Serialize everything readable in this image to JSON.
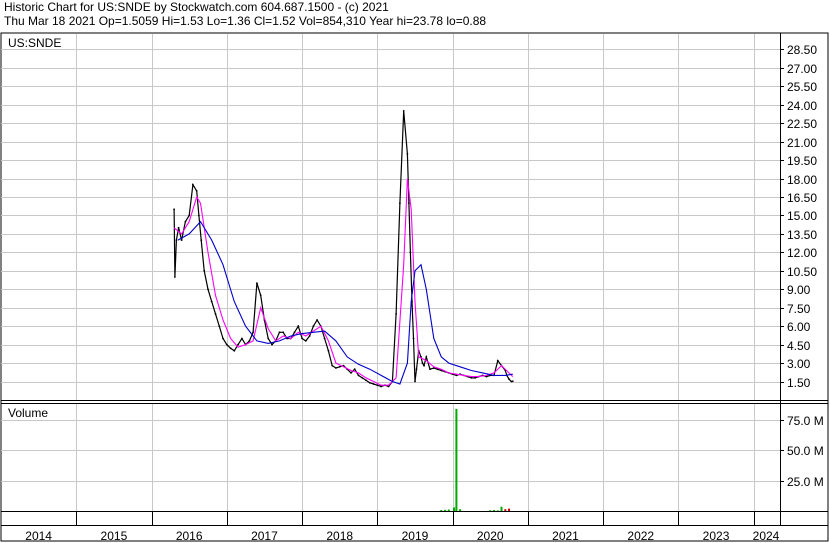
{
  "header": {
    "line1": "Historic Chart for US:SNDE by Stockwatch.com 604.687.1500 - (c) 2021",
    "line2": "Thu Mar 18 2021  Op=1.5059  Hi=1.53  Lo=1.36  Cl=1.52  Vol=854,310  Year hi=23.78  lo=0.88"
  },
  "colors": {
    "price": "#000000",
    "ma_short": "#ff00ff",
    "ma_long": "#0000cc",
    "volume": "#00aa00",
    "volume_down": "#dd0000",
    "grid": "#c8c8c8"
  },
  "chart_data": [
    {
      "type": "line",
      "title": "US:SNDE",
      "y_ticks": [
        "28.50",
        "27.00",
        "25.50",
        "24.00",
        "22.50",
        "21.00",
        "19.50",
        "18.00",
        "16.50",
        "15.00",
        "13.50",
        "12.00",
        "10.50",
        "9.00",
        "7.50",
        "6.00",
        "4.50",
        "3.00",
        "1.50"
      ],
      "y_tick_values": [
        28.5,
        27,
        25.5,
        24,
        22.5,
        21,
        19.5,
        18,
        16.5,
        15,
        13.5,
        12,
        10.5,
        9,
        7.5,
        6,
        4.5,
        3,
        1.5
      ],
      "ylim": [
        0,
        29.75
      ],
      "xlim": [
        2014.0,
        2024.35
      ],
      "x_ticks": [
        "2014",
        "2015",
        "2016",
        "2017",
        "2018",
        "2019",
        "2020",
        "2021",
        "2022",
        "2023",
        "2024"
      ],
      "grid": true,
      "series": [
        {
          "role": "price",
          "x": [
            2016.3,
            2016.31,
            2016.33,
            2016.36,
            2016.4,
            2016.45,
            2016.5,
            2016.55,
            2016.6,
            2016.63,
            2016.66,
            2016.7,
            2016.75,
            2016.8,
            2016.85,
            2016.9,
            2016.95,
            2017.0,
            2017.05,
            2017.1,
            2017.15,
            2017.2,
            2017.25,
            2017.3,
            2017.35,
            2017.4,
            2017.45,
            2017.5,
            2017.55,
            2017.6,
            2017.65,
            2017.7,
            2017.75,
            2017.8,
            2017.85,
            2017.9,
            2017.95,
            2018.0,
            2018.05,
            2018.1,
            2018.15,
            2018.2,
            2018.25,
            2018.3,
            2018.35,
            2018.4,
            2018.45,
            2018.5,
            2018.55,
            2018.6,
            2018.65,
            2018.7,
            2018.75,
            2018.8,
            2018.85,
            2018.9,
            2018.95,
            2019.0,
            2019.05,
            2019.1,
            2019.15,
            2019.2,
            2019.25,
            2019.3,
            2019.35,
            2019.4,
            2019.42,
            2019.44,
            2019.46,
            2019.48,
            2019.5,
            2019.52,
            2019.55,
            2019.58,
            2019.6,
            2019.62,
            2019.65,
            2019.7,
            2019.75,
            2019.8,
            2019.85,
            2019.9,
            2019.95,
            2020.0,
            2020.05,
            2020.1,
            2020.15,
            2020.2,
            2020.25,
            2020.3,
            2020.35,
            2020.4,
            2020.45,
            2020.5,
            2020.55,
            2020.6,
            2020.65,
            2020.7,
            2020.72,
            2020.75,
            2020.78,
            2020.8
          ],
          "values": [
            15.5,
            10.0,
            13.0,
            14.0,
            13.0,
            14.5,
            15.0,
            17.5,
            17.0,
            15.0,
            13.0,
            10.5,
            9.0,
            8.0,
            7.0,
            6.0,
            5.0,
            4.5,
            4.2,
            4.0,
            4.5,
            5.0,
            4.5,
            4.8,
            5.5,
            9.5,
            8.5,
            6.5,
            5.0,
            4.5,
            4.8,
            5.5,
            5.5,
            5.0,
            5.0,
            5.5,
            6.0,
            5.0,
            4.8,
            5.2,
            6.0,
            6.5,
            6.0,
            5.0,
            4.0,
            2.8,
            2.6,
            2.7,
            2.8,
            2.5,
            2.2,
            2.5,
            2.0,
            1.8,
            1.6,
            1.4,
            1.3,
            1.2,
            1.1,
            1.2,
            1.1,
            1.5,
            7.0,
            16.0,
            23.5,
            20.0,
            16.0,
            12.0,
            8.0,
            5.0,
            1.5,
            2.5,
            4.0,
            3.5,
            3.0,
            2.8,
            3.5,
            2.5,
            2.6,
            2.5,
            2.4,
            2.3,
            2.2,
            2.1,
            2.0,
            2.1,
            2.0,
            1.9,
            1.8,
            1.8,
            1.9,
            2.0,
            1.9,
            2.0,
            2.0,
            3.2,
            2.8,
            2.4,
            2.0,
            1.7,
            1.5,
            1.52
          ]
        },
        {
          "role": "ma_short",
          "x": [
            2016.3,
            2016.4,
            2016.5,
            2016.6,
            2016.65,
            2016.75,
            2016.85,
            2016.95,
            2017.05,
            2017.15,
            2017.25,
            2017.35,
            2017.45,
            2017.55,
            2017.65,
            2017.75,
            2017.85,
            2017.95,
            2018.05,
            2018.15,
            2018.25,
            2018.35,
            2018.45,
            2018.55,
            2018.65,
            2018.75,
            2018.85,
            2018.95,
            2019.05,
            2019.15,
            2019.25,
            2019.35,
            2019.4,
            2019.45,
            2019.5,
            2019.55,
            2019.65,
            2019.75,
            2019.85,
            2019.95,
            2020.05,
            2020.15,
            2020.25,
            2020.35,
            2020.45,
            2020.55,
            2020.65,
            2020.75,
            2020.8
          ],
          "values": [
            14.0,
            13.5,
            14.5,
            16.5,
            16.0,
            12.0,
            8.5,
            6.5,
            5.0,
            4.3,
            4.5,
            4.8,
            7.5,
            5.8,
            4.8,
            5.2,
            5.0,
            5.5,
            5.2,
            5.6,
            6.0,
            4.8,
            3.0,
            2.7,
            2.4,
            2.2,
            1.8,
            1.5,
            1.2,
            1.2,
            1.8,
            11.0,
            18.0,
            15.5,
            8.0,
            3.5,
            3.2,
            2.7,
            2.5,
            2.2,
            2.1,
            2.0,
            1.9,
            1.9,
            2.0,
            2.2,
            2.8,
            2.2,
            1.9
          ]
        },
        {
          "role": "ma_long",
          "x": [
            2016.35,
            2016.5,
            2016.65,
            2016.8,
            2016.95,
            2017.1,
            2017.25,
            2017.4,
            2017.55,
            2017.7,
            2017.85,
            2018.0,
            2018.15,
            2018.3,
            2018.45,
            2018.6,
            2018.75,
            2018.9,
            2019.05,
            2019.2,
            2019.3,
            2019.4,
            2019.45,
            2019.5,
            2019.58,
            2019.65,
            2019.75,
            2019.85,
            2019.95,
            2020.1,
            2020.25,
            2020.4,
            2020.55,
            2020.7,
            2020.8
          ],
          "values": [
            13.0,
            13.5,
            14.5,
            13.0,
            11.0,
            8.0,
            6.0,
            4.8,
            4.6,
            4.8,
            5.2,
            5.4,
            5.5,
            5.6,
            4.8,
            3.5,
            2.9,
            2.5,
            2.0,
            1.5,
            1.3,
            3.0,
            8.0,
            10.5,
            11.0,
            9.0,
            5.0,
            3.5,
            3.0,
            2.7,
            2.4,
            2.2,
            2.0,
            2.0,
            2.1
          ]
        }
      ]
    },
    {
      "type": "bar",
      "title": "Volume",
      "y_ticks": [
        "75.0 M",
        "50.0 M",
        "25.0 M"
      ],
      "y_tick_values": [
        75,
        50,
        25
      ],
      "ylim": [
        0,
        88
      ],
      "unit": "M",
      "x": [
        2019.85,
        2019.9,
        2019.95,
        2020.02,
        2020.05,
        2020.1,
        2020.5,
        2020.55,
        2020.6,
        2020.65,
        2020.7,
        2020.75
      ],
      "values": [
        0.8,
        1.0,
        1.2,
        3.0,
        84.0,
        1.5,
        0.6,
        0.8,
        0.5,
        3.5,
        1.5,
        2.0
      ],
      "down": [
        false,
        false,
        false,
        false,
        false,
        false,
        false,
        false,
        false,
        false,
        true,
        true
      ]
    }
  ]
}
